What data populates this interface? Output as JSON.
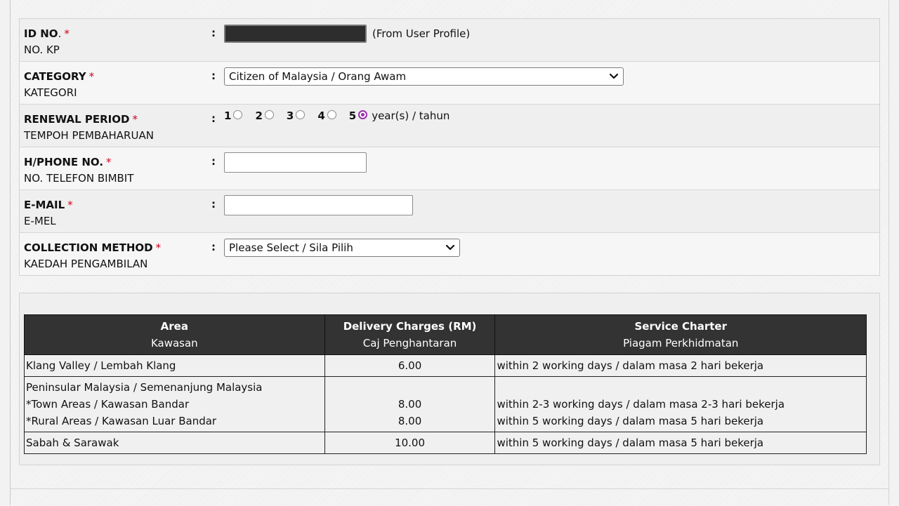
{
  "form": {
    "id_no": {
      "label_en": "ID NO",
      "label_dot": ".",
      "required": "*",
      "label_ms": "NO. KP",
      "colon": ":",
      "value": "",
      "note": "(From User Profile)"
    },
    "category": {
      "label_en": "CATEGORY",
      "required": "*",
      "label_ms": "KATEGORI",
      "colon": ":",
      "selected": "Citizen of Malaysia / Orang Awam"
    },
    "renewal_period": {
      "label_en": "RENEWAL PERIOD",
      "required": "*",
      "label_ms": "TEMPOH PEMBAHARUAN",
      "colon": ":",
      "options": [
        "1",
        "2",
        "3",
        "4",
        "5"
      ],
      "selected": "5",
      "suffix": "year(s) / tahun"
    },
    "hphone": {
      "label_en": "H/PHONE NO.",
      "required": "*",
      "label_ms": "NO. TELEFON BIMBIT",
      "colon": ":",
      "value": ""
    },
    "email": {
      "label_en": "E-MAIL",
      "required": "*",
      "label_ms": "E-MEL",
      "colon": ":",
      "value": ""
    },
    "collection": {
      "label_en": "COLLECTION METHOD",
      "required": "*",
      "label_ms": "KAEDAH PENGAMBILAN",
      "colon": ":",
      "selected": "Please Select / Sila Pilih"
    }
  },
  "charges_table": {
    "headers": [
      {
        "en": "Area",
        "ms": "Kawasan"
      },
      {
        "en": "Delivery Charges (RM)",
        "ms": "Caj Penghantaran"
      },
      {
        "en": "Service Charter",
        "ms": "Piagam Perkhidmatan"
      }
    ],
    "rows": [
      {
        "area": "Klang Valley / Lembah Klang",
        "charge": "6.00",
        "charter": "within 2 working days / dalam masa 2 hari bekerja"
      },
      {
        "area": "Peninsular Malaysia / Semenanjung Malaysia",
        "sub": [
          {
            "area": "*Town Areas / Kawasan Bandar",
            "charge": "8.00",
            "charter": "within 2-3 working days / dalam masa 2-3 hari bekerja"
          },
          {
            "area": "*Rural Areas / Kawasan Luar Bandar",
            "charge": "8.00",
            "charter": "within 5 working days / dalam masa 5 hari bekerja"
          }
        ]
      },
      {
        "area": "Sabah & Sarawak",
        "charge": "10.00",
        "charter": "within 5 working days / dalam masa 5 hari bekerja"
      }
    ]
  },
  "colors": {
    "required": "#d0021b",
    "radio_selected": "#9b2fae",
    "table_header_bg": "#333333"
  },
  "icons": {
    "select_arrow": "chevron-down-icon"
  }
}
